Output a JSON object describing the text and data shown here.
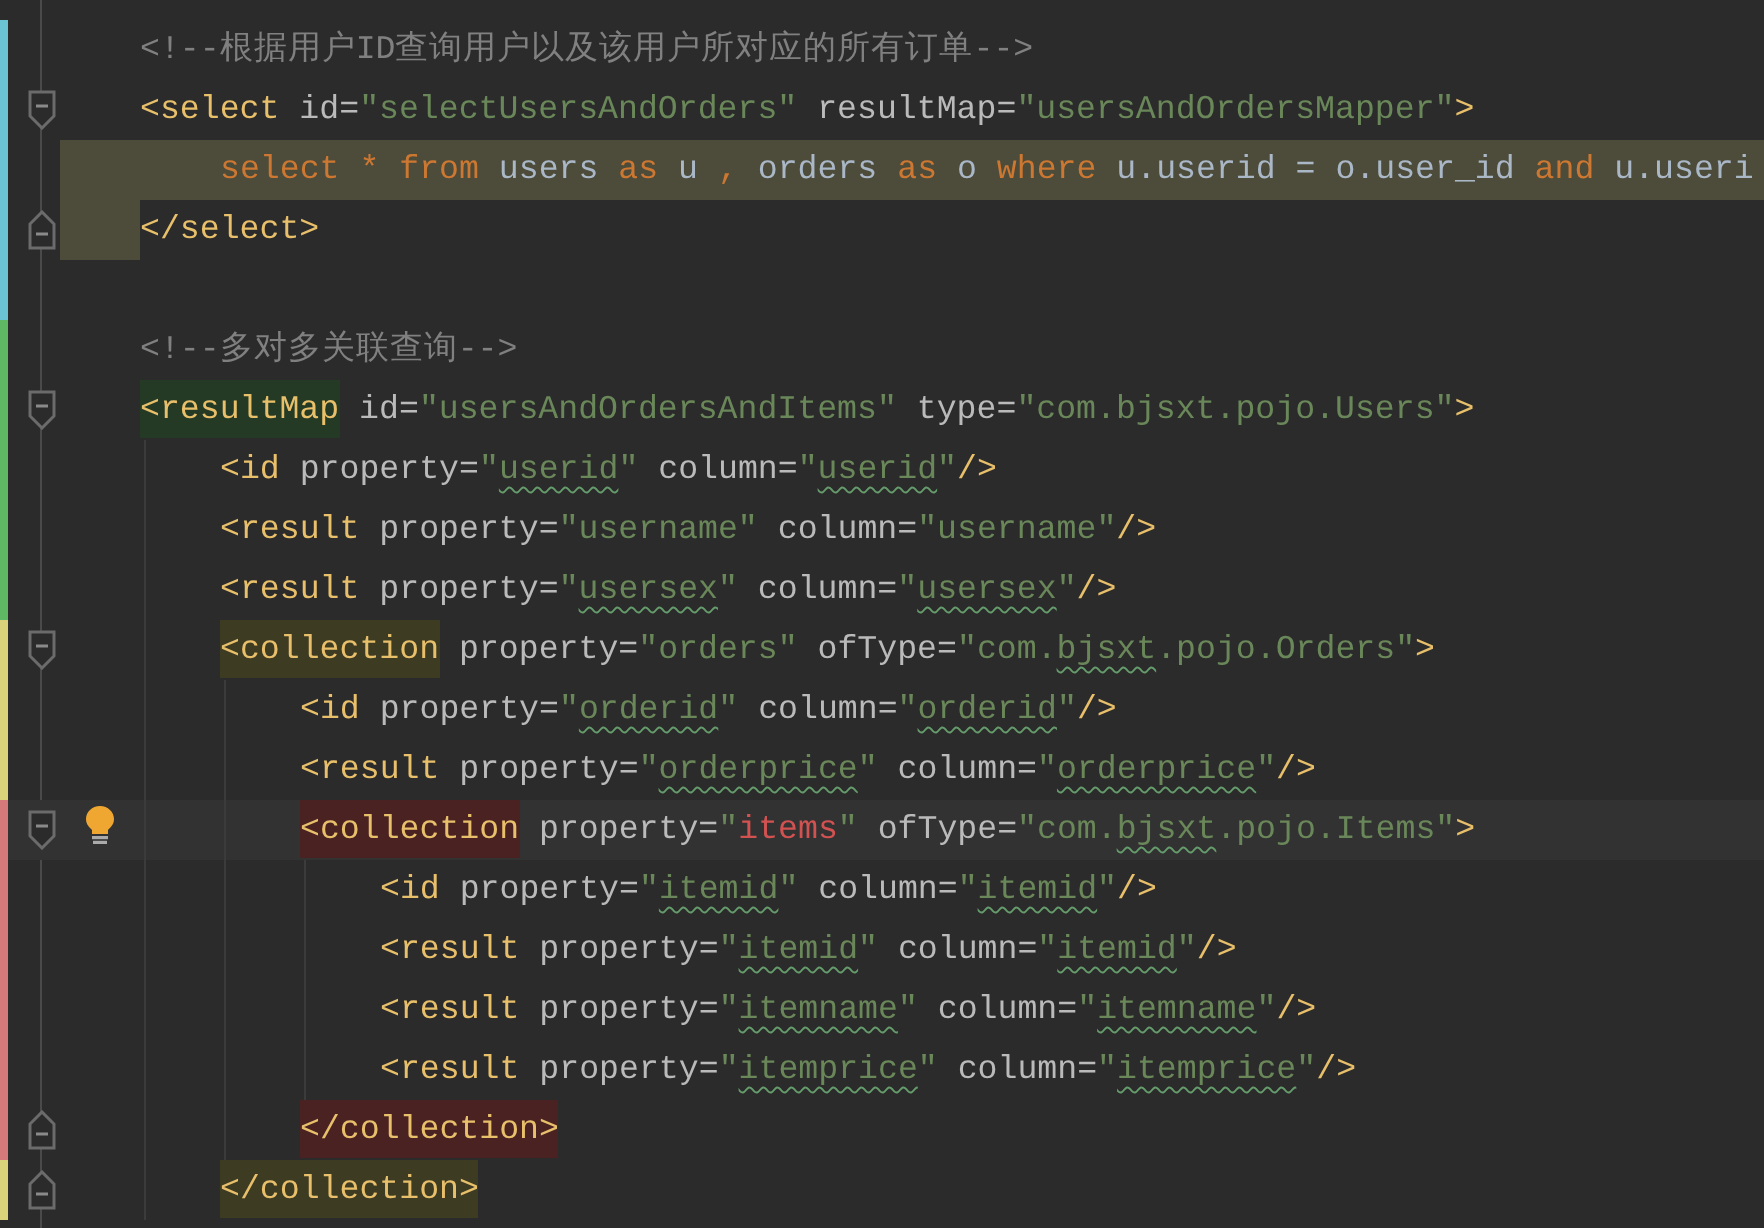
{
  "editor": {
    "lines": [
      {
        "kind": "line",
        "color": "#6bc4d4",
        "current": false,
        "injected": false,
        "bulb": false,
        "tokens": [
          {
            "kind": "comment",
            "text": "<!--根据用户ID查询用户以及该用户所对应的所有订单-->"
          }
        ]
      },
      {
        "kind": "open",
        "color": "#6bc4d4",
        "current": false,
        "injected": false,
        "bulb": false,
        "tokens": [
          {
            "kind": "tag",
            "text": "<select"
          },
          {
            "kind": "attr",
            "text": " id="
          },
          {
            "kind": "value",
            "text": "\"selectUsersAndOrders\""
          },
          {
            "kind": "attr",
            "text": " resultMap="
          },
          {
            "kind": "value",
            "text": "\"usersAndOrdersMapper\""
          },
          {
            "kind": "tag",
            "text": ">"
          }
        ],
        "children": [
          {
            "kind": "line",
            "color": "#6bc4d4",
            "current": false,
            "injected": true,
            "bulb": false,
            "tokens": [
              {
                "kind": "keyword",
                "text": "select * from"
              },
              {
                "kind": "plain",
                "text": " users "
              },
              {
                "kind": "keyword",
                "text": "as"
              },
              {
                "kind": "plain",
                "text": " u "
              },
              {
                "kind": "keyword",
                "text": ","
              },
              {
                "kind": "plain",
                "text": " orders "
              },
              {
                "kind": "keyword",
                "text": "as"
              },
              {
                "kind": "plain",
                "text": " o "
              },
              {
                "kind": "keyword",
                "text": "where"
              },
              {
                "kind": "plain",
                "text": " u.userid = o.user_id "
              },
              {
                "kind": "keyword",
                "text": "and"
              },
              {
                "kind": "plain",
                "text": " u.useri"
              }
            ]
          }
        ]
      },
      {
        "kind": "close",
        "color": "#6bc4d4",
        "current": false,
        "injected": false,
        "bulb": false,
        "tokens": [
          {
            "kind": "tag",
            "text": "</select>"
          }
        ]
      },
      {
        "kind": "line",
        "color": "#6bc4d4",
        "current": false,
        "injected": false,
        "bulb": false
      },
      {
        "kind": "line",
        "color": "#5fb864",
        "current": false,
        "injected": false,
        "bulb": false,
        "tokens": [
          {
            "kind": "comment",
            "text": "<!--多对多关联查询-->"
          }
        ]
      },
      {
        "kind": "open",
        "color": "#5fb864",
        "current": false,
        "injected": false,
        "bulb": false,
        "tokens": [
          {
            "kind": "tag",
            "text": "<resultMap",
            "color": "#243a25"
          },
          {
            "kind": "attr",
            "text": " id="
          },
          {
            "kind": "value",
            "text": "\"usersAndOrdersAndItems\""
          },
          {
            "kind": "attr",
            "text": " type="
          },
          {
            "kind": "value",
            "text": "\"com.bjsxt.pojo.Users\""
          },
          {
            "kind": "tag",
            "text": ">"
          }
        ],
        "children": [
          {
            "kind": "line",
            "color": "#5fb864",
            "current": false,
            "injected": false,
            "bulb": false,
            "tokens": [
              {
                "kind": "tag",
                "text": "<id"
              },
              {
                "kind": "attr",
                "text": " property="
              },
              {
                "kind": "value",
                "text": "\""
              },
              {
                "kind": "typo",
                "text": "userid"
              },
              {
                "kind": "value",
                "text": "\""
              },
              {
                "kind": "attr",
                "text": " column="
              },
              {
                "kind": "value",
                "text": "\""
              },
              {
                "kind": "typo",
                "text": "userid"
              },
              {
                "kind": "value",
                "text": "\""
              },
              {
                "kind": "tag",
                "text": "/>"
              }
            ]
          },
          {
            "kind": "line",
            "color": "#5fb864",
            "current": false,
            "injected": false,
            "bulb": false,
            "tokens": [
              {
                "kind": "tag",
                "text": "<result"
              },
              {
                "kind": "attr",
                "text": " property="
              },
              {
                "kind": "value",
                "text": "\"username\""
              },
              {
                "kind": "attr",
                "text": " column="
              },
              {
                "kind": "value",
                "text": "\"username\""
              },
              {
                "kind": "tag",
                "text": "/>"
              }
            ]
          },
          {
            "kind": "line",
            "color": "#5fb864",
            "current": false,
            "injected": false,
            "bulb": false,
            "tokens": [
              {
                "kind": "tag",
                "text": "<result"
              },
              {
                "kind": "attr",
                "text": " property="
              },
              {
                "kind": "value",
                "text": "\""
              },
              {
                "kind": "typo",
                "text": "usersex"
              },
              {
                "kind": "value",
                "text": "\""
              },
              {
                "kind": "attr",
                "text": " column="
              },
              {
                "kind": "value",
                "text": "\""
              },
              {
                "kind": "typo",
                "text": "usersex"
              },
              {
                "kind": "value",
                "text": "\""
              },
              {
                "kind": "tag",
                "text": "/>"
              }
            ]
          },
          {
            "kind": "open",
            "color": "#d9d27a",
            "current": false,
            "injected": false,
            "bulb": false,
            "tokens": [
              {
                "kind": "tag",
                "text": "<collection",
                "color": "#3d3b22"
              },
              {
                "kind": "attr",
                "text": " property="
              },
              {
                "kind": "value",
                "text": "\"orders\""
              },
              {
                "kind": "attr",
                "text": " ofType="
              },
              {
                "kind": "value",
                "text": "\"com."
              },
              {
                "kind": "typo",
                "text": "bjsxt"
              },
              {
                "kind": "value",
                "text": ".pojo.Orders\""
              },
              {
                "kind": "tag",
                "text": ">"
              }
            ],
            "children": [
              {
                "kind": "line",
                "color": "#d9d27a",
                "current": false,
                "injected": false,
                "bulb": false,
                "tokens": [
                  {
                    "kind": "tag",
                    "text": "<id"
                  },
                  {
                    "kind": "attr",
                    "text": " property="
                  },
                  {
                    "kind": "value",
                    "text": "\""
                  },
                  {
                    "kind": "typo",
                    "text": "orderid"
                  },
                  {
                    "kind": "value",
                    "text": "\""
                  },
                  {
                    "kind": "attr",
                    "text": " column="
                  },
                  {
                    "kind": "value",
                    "text": "\""
                  },
                  {
                    "kind": "typo",
                    "text": "orderid"
                  },
                  {
                    "kind": "value",
                    "text": "\""
                  },
                  {
                    "kind": "tag",
                    "text": "/>"
                  }
                ]
              },
              {
                "kind": "line",
                "color": "#d9d27a",
                "current": false,
                "injected": false,
                "bulb": false,
                "tokens": [
                  {
                    "kind": "tag",
                    "text": "<result"
                  },
                  {
                    "kind": "attr",
                    "text": " property="
                  },
                  {
                    "kind": "value",
                    "text": "\""
                  },
                  {
                    "kind": "typo",
                    "text": "orderprice"
                  },
                  {
                    "kind": "value",
                    "text": "\""
                  },
                  {
                    "kind": "attr",
                    "text": " column="
                  },
                  {
                    "kind": "value",
                    "text": "\""
                  },
                  {
                    "kind": "typo",
                    "text": "orderprice"
                  },
                  {
                    "kind": "value",
                    "text": "\""
                  },
                  {
                    "kind": "tag",
                    "text": "/>"
                  }
                ]
              },
              {
                "kind": "open",
                "color": "#d47a7a",
                "current": true,
                "injected": false,
                "bulb": true,
                "tokens": [
                  {
                    "kind": "tag",
                    "text": "<collection",
                    "color": "#4a2222"
                  },
                  {
                    "kind": "attr",
                    "text": " property="
                  },
                  {
                    "kind": "value",
                    "text": "\""
                  },
                  {
                    "kind": "error",
                    "text": "items"
                  },
                  {
                    "kind": "value",
                    "text": "\""
                  },
                  {
                    "kind": "attr",
                    "text": " ofType="
                  },
                  {
                    "kind": "value",
                    "text": "\"com."
                  },
                  {
                    "kind": "typo",
                    "text": "bjsxt"
                  },
                  {
                    "kind": "value",
                    "text": ".pojo.Items\""
                  },
                  {
                    "kind": "tag",
                    "text": ">"
                  }
                ],
                "children": [
                  {
                    "kind": "line",
                    "color": "#d47a7a",
                    "current": false,
                    "injected": false,
                    "bulb": false,
                    "tokens": [
                      {
                        "kind": "tag",
                        "text": "<id"
                      },
                      {
                        "kind": "attr",
                        "text": " property="
                      },
                      {
                        "kind": "value",
                        "text": "\""
                      },
                      {
                        "kind": "typo",
                        "text": "itemid"
                      },
                      {
                        "kind": "value",
                        "text": "\""
                      },
                      {
                        "kind": "attr",
                        "text": " column="
                      },
                      {
                        "kind": "value",
                        "text": "\""
                      },
                      {
                        "kind": "typo",
                        "text": "itemid"
                      },
                      {
                        "kind": "value",
                        "text": "\""
                      },
                      {
                        "kind": "tag",
                        "text": "/>"
                      }
                    ]
                  },
                  {
                    "kind": "line",
                    "color": "#d47a7a",
                    "current": false,
                    "injected": false,
                    "bulb": false,
                    "tokens": [
                      {
                        "kind": "tag",
                        "text": "<result"
                      },
                      {
                        "kind": "attr",
                        "text": " property="
                      },
                      {
                        "kind": "value",
                        "text": "\""
                      },
                      {
                        "kind": "typo",
                        "text": "itemid"
                      },
                      {
                        "kind": "value",
                        "text": "\""
                      },
                      {
                        "kind": "attr",
                        "text": " column="
                      },
                      {
                        "kind": "value",
                        "text": "\""
                      },
                      {
                        "kind": "typo",
                        "text": "itemid"
                      },
                      {
                        "kind": "value",
                        "text": "\""
                      },
                      {
                        "kind": "tag",
                        "text": "/>"
                      }
                    ]
                  },
                  {
                    "kind": "line",
                    "color": "#d47a7a",
                    "current": false,
                    "injected": false,
                    "bulb": false,
                    "tokens": [
                      {
                        "kind": "tag",
                        "text": "<result"
                      },
                      {
                        "kind": "attr",
                        "text": " property="
                      },
                      {
                        "kind": "value",
                        "text": "\""
                      },
                      {
                        "kind": "typo",
                        "text": "itemname"
                      },
                      {
                        "kind": "value",
                        "text": "\""
                      },
                      {
                        "kind": "attr",
                        "text": " column="
                      },
                      {
                        "kind": "value",
                        "text": "\""
                      },
                      {
                        "kind": "typo",
                        "text": "itemname"
                      },
                      {
                        "kind": "value",
                        "text": "\""
                      },
                      {
                        "kind": "tag",
                        "text": "/>"
                      }
                    ]
                  },
                  {
                    "kind": "line",
                    "color": "#d47a7a",
                    "current": false,
                    "injected": false,
                    "bulb": false,
                    "tokens": [
                      {
                        "kind": "tag",
                        "text": "<result"
                      },
                      {
                        "kind": "attr",
                        "text": " property="
                      },
                      {
                        "kind": "value",
                        "text": "\""
                      },
                      {
                        "kind": "typo",
                        "text": "itemprice"
                      },
                      {
                        "kind": "value",
                        "text": "\""
                      },
                      {
                        "kind": "attr",
                        "text": " column="
                      },
                      {
                        "kind": "value",
                        "text": "\""
                      },
                      {
                        "kind": "typo",
                        "text": "itemprice"
                      },
                      {
                        "kind": "value",
                        "text": "\""
                      },
                      {
                        "kind": "tag",
                        "text": "/>"
                      }
                    ]
                  }
                ]
              },
              {
                "kind": "close",
                "color": "#d47a7a",
                "current": false,
                "injected": false,
                "bulb": false,
                "tokens": [
                  {
                    "kind": "tag",
                    "text": "</collection>",
                    "color": "#4a2222"
                  }
                ]
              }
            ]
          },
          {
            "kind": "close",
            "color": "#d9d27a",
            "current": false,
            "injected": false,
            "bulb": false,
            "tokens": [
              {
                "kind": "tag",
                "text": "</collection>",
                "color": "#3d3b22"
              }
            ]
          }
        ]
      }
    ]
  }
}
